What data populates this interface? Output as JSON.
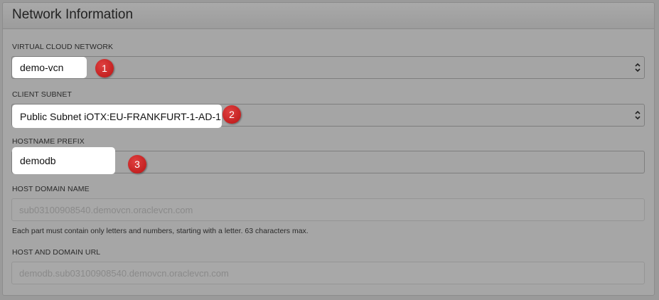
{
  "panel": {
    "title": "Network Information"
  },
  "vcn": {
    "label": "VIRTUAL CLOUD NETWORK",
    "value": "demo-vcn",
    "badge": "1"
  },
  "subnet": {
    "label": "CLIENT SUBNET",
    "value": "Public Subnet iOTX:EU-FRANKFURT-1-AD-1",
    "badge": "2"
  },
  "hostname": {
    "label": "HOSTNAME PREFIX",
    "value": "demodb",
    "badge": "3"
  },
  "domain": {
    "label": "HOST DOMAIN NAME",
    "value": "sub03100908540.demovcn.oraclevcn.com",
    "help": "Each part must contain only letters and numbers, starting with a letter. 63 characters max."
  },
  "url": {
    "label": "HOST AND DOMAIN URL",
    "value": "demodb.sub03100908540.demovcn.oraclevcn.com"
  },
  "colors": {
    "badge": "#c81e1e",
    "overlay": "#a6a6a6"
  }
}
